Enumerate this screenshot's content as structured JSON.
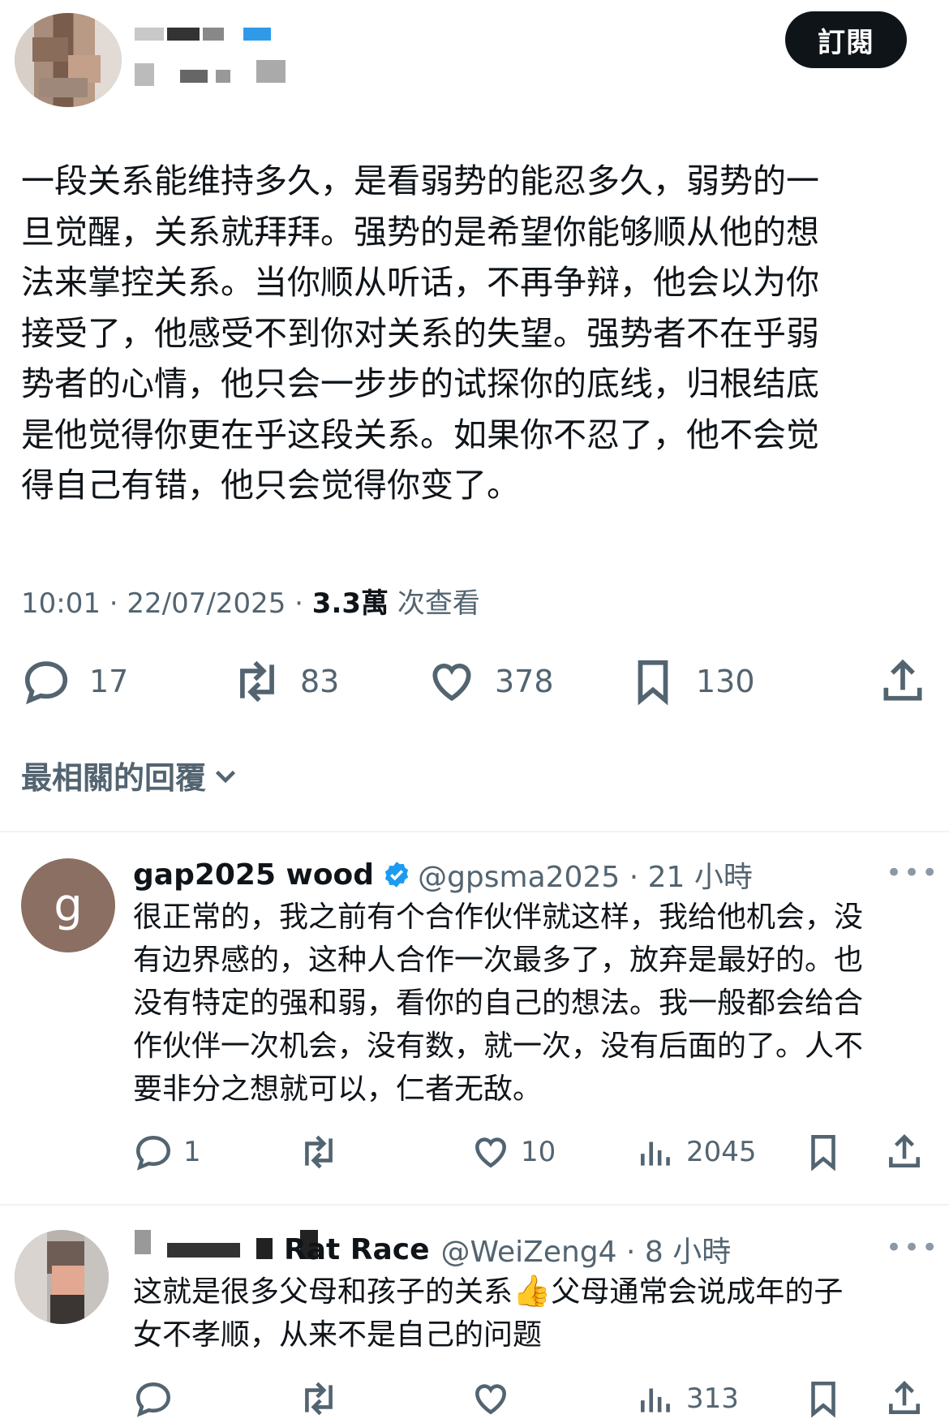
{
  "header": {
    "subscribe_label": "訂閱"
  },
  "tweet": {
    "text": "一段关系能维持多久，是看弱势的能忍多久，弱势的一\n旦觉醒，关系就拜拜。强势的是希望你能够顺从他的想\n法来掌控关系。当你顺从听话，不再争辩，他会以为你\n接受了，他感受不到你对关系的失望。强势者不在乎弱\n势者的心情，他只会一步步的试探你的底线，归根结底\n是他觉得你更在乎这段关系。如果你不忍了，他不会觉\n得自己有错，他只会觉得你变了。",
    "time": "10:01 · 22/07/2025 · ",
    "views_count": "3.3萬",
    "views_label": " 次查看",
    "stats": {
      "replies": "17",
      "retweets": "83",
      "likes": "378",
      "bookmarks": "130"
    }
  },
  "replies_sort": {
    "label": "最相關的回覆"
  },
  "replies": [
    {
      "avatar_letter": "g",
      "avatar_color": "#8b6f62",
      "name": "gap2025 wood",
      "handle": "@gpsma2025 · 21 小時",
      "more": "•••",
      "text": "很正常的，我之前有个合作伙伴就这样，我给他机会，没\n有边界感的，这种人合作一次最多了，放弃是最好的。也\n没有特定的强和弱，看你的自己的想法。我一般都会给合\n作伙伴一次机会，没有数，就一次，没有后面的了。人不\n要非分之想就可以，仁者无敌。",
      "stats": {
        "replies": "1",
        "likes": "10",
        "views": "2045"
      }
    },
    {
      "name_visible": "Rat Race",
      "handle": "@WeiZeng4 · 8 小時",
      "more": "•••",
      "text_line1": "这就是很多父母和孩子的关系",
      "emoji": "👍",
      "text_line1b": "父母通常会说成年的子",
      "text_line2": "女不孝顺，从来不是自己的问题",
      "stats": {
        "views": "313"
      }
    }
  ],
  "colors": {
    "text_primary": "#0f1419",
    "text_secondary": "#536471",
    "verified_blue": "#1d9bf0",
    "divider": "#eff3f4"
  },
  "icons": [
    "reply-icon",
    "retweet-icon",
    "like-icon",
    "bookmark-icon",
    "share-icon",
    "views-icon",
    "verified-icon",
    "chevron-down-icon",
    "more-icon"
  ]
}
